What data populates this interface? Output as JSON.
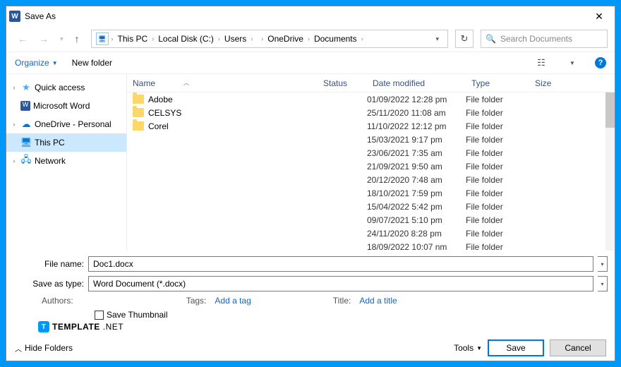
{
  "window": {
    "title": "Save As"
  },
  "breadcrumbs": {
    "items": [
      "This PC",
      "Local Disk (C:)",
      "Users",
      "",
      "OneDrive",
      "Documents",
      ""
    ]
  },
  "search": {
    "placeholder": "Search Documents"
  },
  "toolbar": {
    "organize": "Organize",
    "new_folder": "New folder"
  },
  "sidebar": {
    "items": [
      {
        "label": "Quick access",
        "selected": false,
        "exp": "❯"
      },
      {
        "label": "Microsoft Word",
        "selected": false,
        "exp": ""
      },
      {
        "label": "OneDrive - Personal",
        "selected": false,
        "exp": "❯"
      },
      {
        "label": "This PC",
        "selected": true,
        "exp": "❯"
      },
      {
        "label": "Network",
        "selected": false,
        "exp": "❯"
      }
    ]
  },
  "columns": {
    "name": "Name",
    "status": "Status",
    "date": "Date modified",
    "type": "Type",
    "size": "Size"
  },
  "files": [
    {
      "name": "Adobe",
      "date": "01/09/2022 12:28 pm",
      "type": "File folder"
    },
    {
      "name": "CELSYS",
      "date": "25/11/2020 11:08 am",
      "type": "File folder"
    },
    {
      "name": "Corel",
      "date": "11/10/2022 12:12 pm",
      "type": "File folder"
    },
    {
      "name": "",
      "date": "15/03/2021 9:17 pm",
      "type": "File folder"
    },
    {
      "name": "",
      "date": "23/06/2021 7:35 am",
      "type": "File folder"
    },
    {
      "name": "",
      "date": "21/09/2021 9:50 am",
      "type": "File folder"
    },
    {
      "name": "",
      "date": "20/12/2020 7:48 am",
      "type": "File folder"
    },
    {
      "name": "",
      "date": "18/10/2021 7:59 pm",
      "type": "File folder"
    },
    {
      "name": "",
      "date": "15/04/2022 5:42 pm",
      "type": "File folder"
    },
    {
      "name": "",
      "date": "09/07/2021 5:10 pm",
      "type": "File folder"
    },
    {
      "name": "",
      "date": "24/11/2020 8:28 pm",
      "type": "File folder"
    },
    {
      "name": "",
      "date": "18/09/2022 10:07 nm",
      "type": "File folder"
    }
  ],
  "form": {
    "filename_label": "File name:",
    "filename_value": "Doc1.docx",
    "saveastype_label": "Save as type:",
    "saveastype_value": "Word Document (*.docx)",
    "authors_label": "Authors:",
    "tags_label": "Tags:",
    "tags_link": "Add a tag",
    "title_label": "Title:",
    "title_link": "Add a title",
    "save_thumbnail": "Save Thumbnail"
  },
  "branding": {
    "template": "TEMPLATE",
    "net": ".NET"
  },
  "footer": {
    "hide": "Hide Folders",
    "tools": "Tools",
    "save": "Save",
    "cancel": "Cancel"
  }
}
